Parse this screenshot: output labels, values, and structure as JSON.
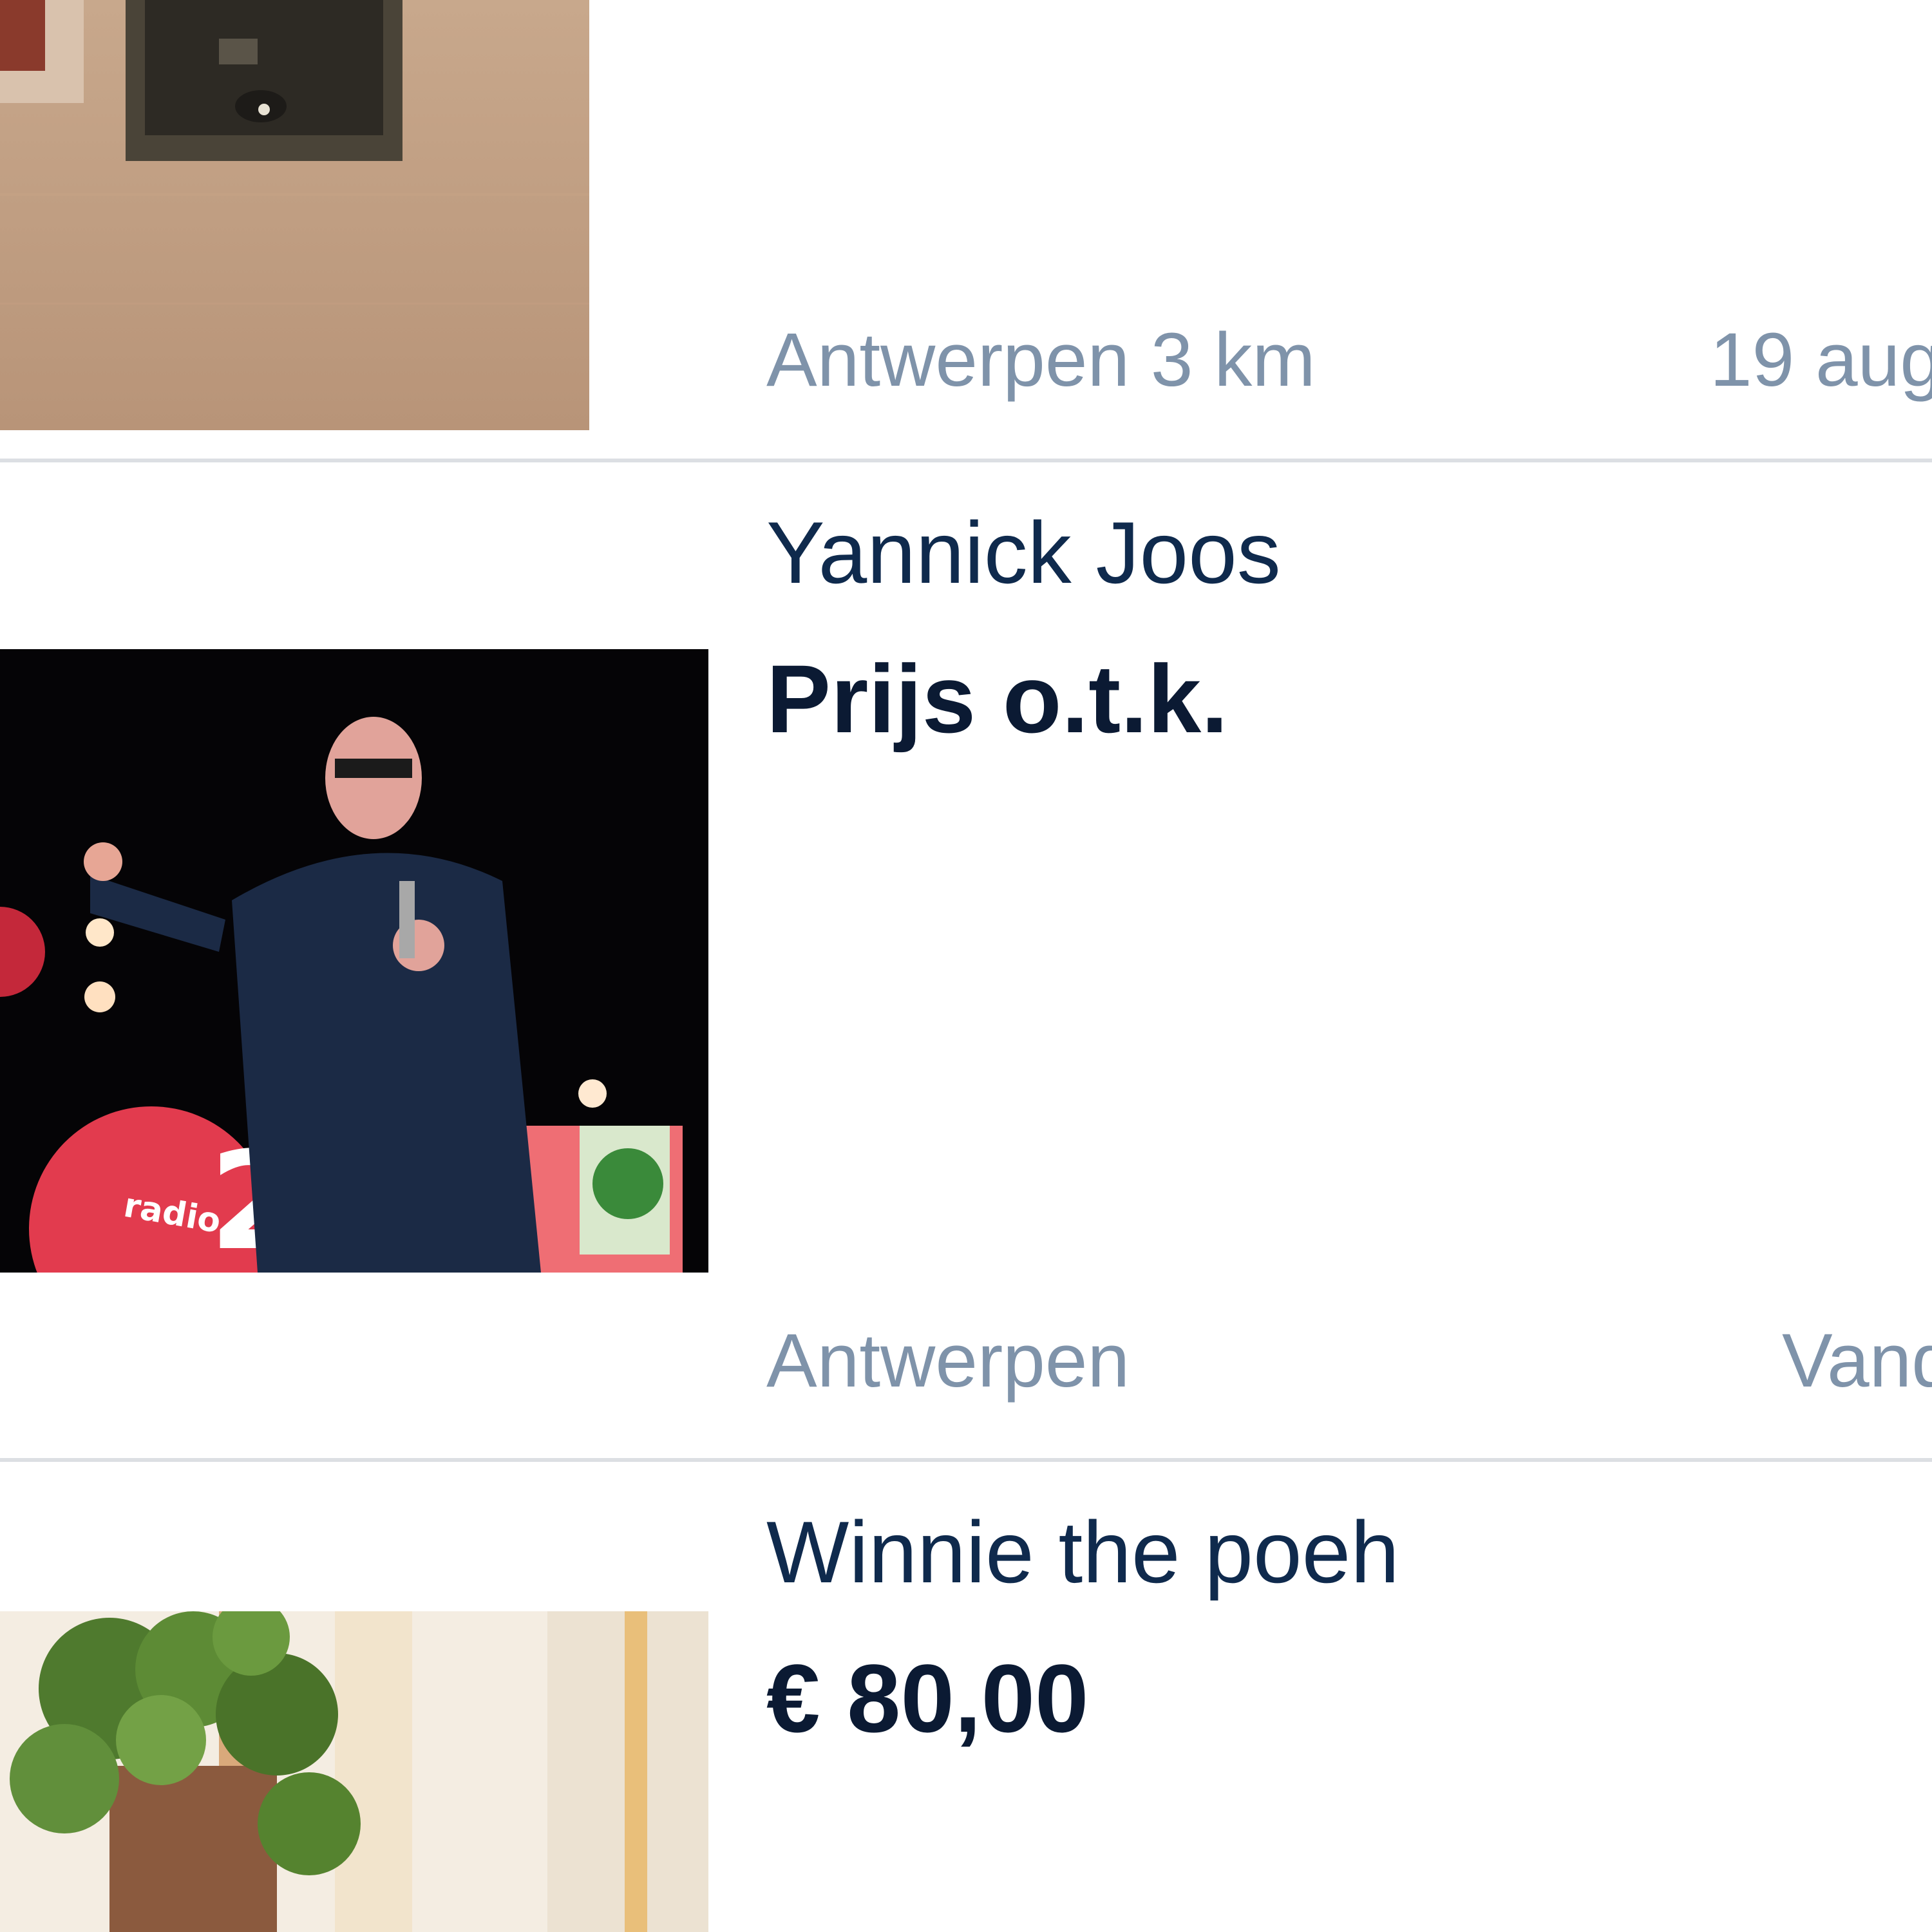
{
  "listings": [
    {
      "location": "Antwerpen 3 km",
      "date": "19 aug"
    },
    {
      "title": "Yannick Joos",
      "price": "Prijs o.t.k.",
      "location": "Antwerpen",
      "date": "Vand"
    },
    {
      "title": "Winnie the poeh",
      "price": "€ 80,00"
    }
  ]
}
